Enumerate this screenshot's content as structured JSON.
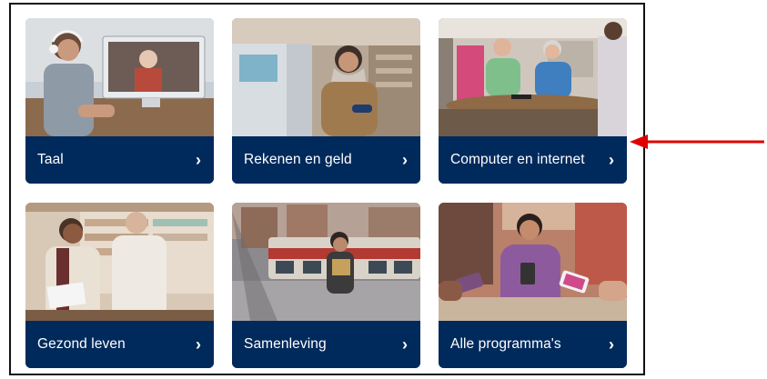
{
  "cards": [
    {
      "label": "Taal",
      "photo": "woman-with-headphones-video-call"
    },
    {
      "label": "Rekenen en geld",
      "photo": "woman-with-headscarf-at-atm"
    },
    {
      "label": "Computer en internet",
      "photo": "seniors-with-tablets-at-table"
    },
    {
      "label": "Gezond leven",
      "photo": "men-at-pharmacy-counter"
    },
    {
      "label": "Samenleving",
      "photo": "woman-in-city-street-tram"
    },
    {
      "label": "Alle programma's",
      "photo": "women-using-phones"
    }
  ],
  "chevron": "›",
  "colors": {
    "card_bar": "#002a5c",
    "label_text": "#ffffff",
    "arrow": "#e00000",
    "frame_border": "#111111"
  },
  "annotation": {
    "type": "arrow",
    "points_to": "Computer en internet"
  }
}
